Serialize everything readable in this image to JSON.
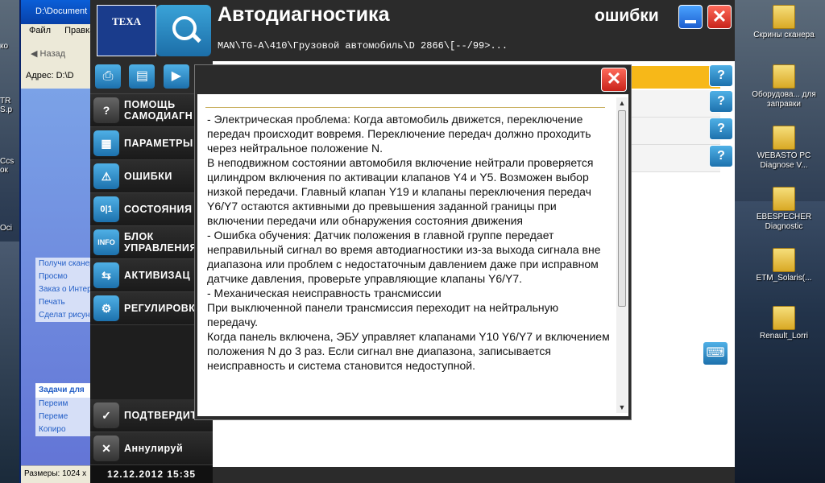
{
  "desktop": {
    "icons": [
      {
        "label": "Скрины сканера"
      },
      {
        "label": "Оборудова... для заправки"
      },
      {
        "label": "WEBASTO PC Diagnose V..."
      },
      {
        "label": "EBESPECHER Diagnostic"
      },
      {
        "label": "ETM_Solaris(..."
      },
      {
        "label": "Renault_Lorri"
      }
    ],
    "left_clips": [
      "ко",
      "TR S.p",
      "Ccs ок",
      "Oci"
    ]
  },
  "explorer": {
    "title": "D:\\Document",
    "menu": [
      "Файл",
      "Правка"
    ],
    "back_label": "Назад",
    "address_label": "Адрес:",
    "address_value": "D:\\D",
    "tasks": [
      "Получи сканера",
      "Просмо",
      "Заказ о Интерн",
      "Печать",
      "Сделат рисунк"
    ],
    "tasks_header": "Задачи для",
    "file_tasks": [
      "Переим",
      "Переме",
      "Копиро"
    ],
    "status": "Размеры: 1024 x"
  },
  "app": {
    "logo": "TEXA",
    "title": "Автодиагностика",
    "path": "MAN\\TG-A\\410\\Грузовой автомобиль\\D 2866\\[--/99>...",
    "section": "ошибки",
    "close_glyph": "✕",
    "sidebar": {
      "items": [
        {
          "label": "ПОМОЩЬ\nСАМОДИАГН",
          "icon": "?"
        },
        {
          "label": "ПАРАМЕТРЫ",
          "icon": "▦"
        },
        {
          "label": "ОШИБКИ",
          "icon": "⚠"
        },
        {
          "label": "СОСТОЯНИЯ",
          "icon": "0|1"
        },
        {
          "label": "БЛОК\nУПРАВЛЕНИЯ",
          "icon": "INFO"
        },
        {
          "label": "АКТИВИЗАЦ",
          "icon": "⇆"
        },
        {
          "label": "РЕГУЛИРОВК",
          "icon": "⚙"
        }
      ],
      "confirm": "ПОДТВЕРДИТЬ",
      "cancel": "Аннулируй",
      "datetime": "12.12.2012  15:35"
    },
    "help_glyph": "?",
    "keyboard_glyph": "⌨"
  },
  "modal": {
    "close_glyph": "✕",
    "paragraphs": [
      "- Электрическая проблема: Когда автомобиль движется, переключение передач происходит вовремя. Переключение передач должно проходить через нейтральное положение N.",
      "В неподвижном состоянии автомобиля включение нейтрали проверяется цилиндром включения по активации клапанов Y4 и Y5. Возможен выбор низкой передачи. Главный клапан Y19 и клапаны переключения передач Y6/Y7 остаются активными до превышения заданной границы при включении передачи или обнаружения состояния движения",
      "- Ошибка обучения: Датчик положения в главной группе передает неправильный сигнал во время автодиагностики из-за выхода сигнала вне диапазона или проблем с недостаточным давлением даже при исправном датчике давления, проверьте управляющие клапаны Y6/Y7.",
      "- Механическая неисправность трансмиссии",
      "При выключенной панели трансмиссия переходит на нейтральную передачу.",
      "Когда панель включена, ЭБУ управляет клапанами Y10 Y6/Y7 и включением положения N до 3 раз. Если сигнал вне диапазона, записывается неисправность и система становится недоступной."
    ]
  }
}
